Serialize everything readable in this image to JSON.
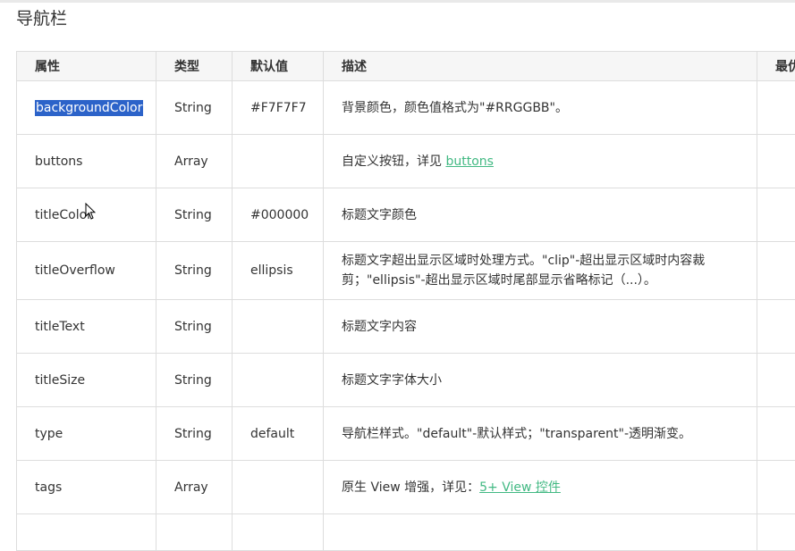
{
  "section_title": "导航栏",
  "table": {
    "headers": [
      "属性",
      "类型",
      "默认值",
      "描述",
      "最优"
    ],
    "rows": [
      {
        "name": "backgroundColor",
        "type": "String",
        "default": "#F7F7F7",
        "desc": "背景颜色，颜色值格式为\"#RRGGBB\"。",
        "link": ""
      },
      {
        "name": "buttons",
        "type": "Array",
        "default": "",
        "desc": "自定义按钮，详见 ",
        "link": "buttons"
      },
      {
        "name": "titleColor",
        "type": "String",
        "default": "#000000",
        "desc": "标题文字颜色",
        "link": ""
      },
      {
        "name": "titleOverflow",
        "type": "String",
        "default": "ellipsis",
        "desc": "标题文字超出显示区域时处理方式。\"clip\"-超出显示区域时内容裁剪；\"ellipsis\"-超出显示区域时尾部显示省略标记（...）。",
        "link": ""
      },
      {
        "name": "titleText",
        "type": "String",
        "default": "",
        "desc": "标题文字内容",
        "link": ""
      },
      {
        "name": "titleSize",
        "type": "String",
        "default": "",
        "desc": "标题文字字体大小",
        "link": ""
      },
      {
        "name": "type",
        "type": "String",
        "default": "default",
        "desc": "导航栏样式。\"default\"-默认样式；\"transparent\"-透明渐变。",
        "link": ""
      },
      {
        "name": "tags",
        "type": "Array",
        "default": "",
        "desc": "原生 View 增强，详见：",
        "link": "5+ View 控件"
      }
    ]
  },
  "colors": {
    "link": "#42b983",
    "selection": "#2c63c9",
    "header_bg": "#f6f6f6",
    "border": "#dddddd"
  }
}
